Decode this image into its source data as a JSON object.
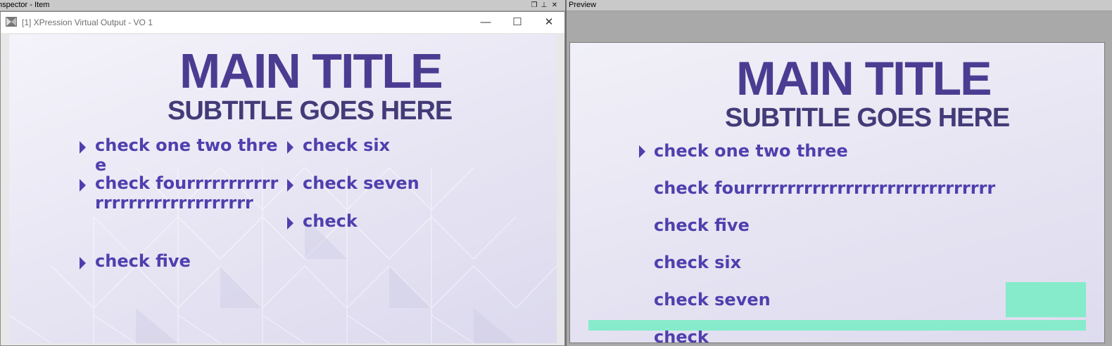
{
  "inspector": {
    "title": "nspector - Item"
  },
  "vo_window": {
    "title": "[1] XPression Virtual Output - VO 1",
    "controls": {
      "minimize": "—",
      "maximize": "☐",
      "close": "✕"
    }
  },
  "graphic": {
    "main_title": "MAIN TITLE",
    "subtitle": "SUBTITLE GOES HERE",
    "bullets_col1": [
      "check one two three",
      "check fourrrrrrrrrrrrrrrrrrrrrrrrrrrrrr",
      "check five"
    ],
    "bullets_col2": [
      "check six",
      "check seven",
      "check"
    ]
  },
  "preview": {
    "title": "Preview",
    "lines": [
      "check one two three",
      "check fourrrrrrrrrrrrrrrrrrrrrrrrrrrrrr",
      "check five",
      "check six",
      "check seven",
      "check"
    ]
  },
  "colors": {
    "title": "#4b3c92",
    "bullet": "#4f3fae",
    "overlay": "#86ebcb"
  },
  "icons": {
    "app": "xpression-logo-icon",
    "restore": "restore-icon",
    "pin": "pin-icon",
    "close": "close-icon"
  }
}
